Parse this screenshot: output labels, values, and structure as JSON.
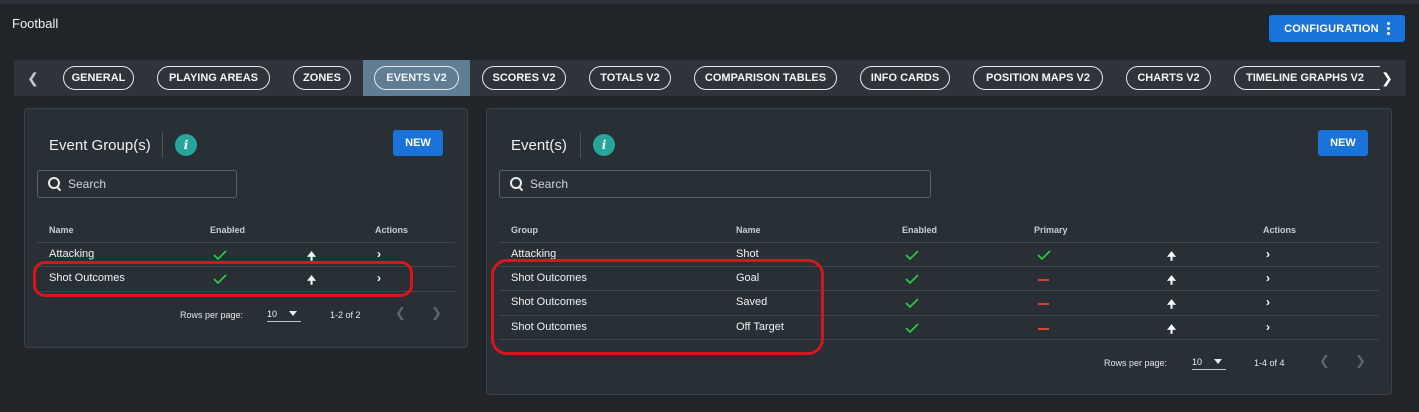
{
  "app": {
    "title": "Football",
    "configuration_label": "CONFIGURATION"
  },
  "tabs": [
    "GENERAL",
    "PLAYING AREAS",
    "ZONES",
    "EVENTS V2",
    "SCORES V2",
    "TOTALS V2",
    "COMPARISON TABLES",
    "INFO CARDS",
    "POSITION MAPS V2",
    "CHARTS V2",
    "TIMELINE GRAPHS V2"
  ],
  "active_tab": "EVENTS V2",
  "icons": {
    "prev": "chevron-left-icon",
    "next": "chevron-right-icon",
    "info": "info-icon",
    "search": "search-icon",
    "check": "check-icon",
    "dash": "dash-icon",
    "up": "arrow-up-icon",
    "row_action": "chevron-right-icon",
    "kebab": "more-vert-icon"
  },
  "colors": {
    "accent": "#1a73d9",
    "info": "#26a69a",
    "check": "#2ecc40",
    "dash": "#d5462f",
    "highlight": "#d8141c",
    "active_tab": "#5f7d94"
  },
  "event_groups": {
    "title": "Event Group(s)",
    "new_label": "NEW",
    "search_placeholder": "Search",
    "columns": {
      "name": "Name",
      "enabled": "Enabled",
      "actions": "Actions"
    },
    "rows": [
      {
        "name": "Attacking",
        "enabled": true
      },
      {
        "name": "Shot Outcomes",
        "enabled": true
      }
    ],
    "pagination": {
      "rows_label": "Rows per page:",
      "rows_value": "10",
      "range": "1-2 of 2"
    }
  },
  "events": {
    "title": "Event(s)",
    "new_label": "NEW",
    "search_placeholder": "Search",
    "columns": {
      "group": "Group",
      "name": "Name",
      "enabled": "Enabled",
      "primary": "Primary",
      "actions": "Actions"
    },
    "rows": [
      {
        "group": "Attacking",
        "name": "Shot",
        "enabled": true,
        "primary": true
      },
      {
        "group": "Shot Outcomes",
        "name": "Goal",
        "enabled": true,
        "primary": false
      },
      {
        "group": "Shot Outcomes",
        "name": "Saved",
        "enabled": true,
        "primary": false
      },
      {
        "group": "Shot Outcomes",
        "name": "Off Target",
        "enabled": true,
        "primary": false
      }
    ],
    "pagination": {
      "rows_label": "Rows per page:",
      "rows_value": "10",
      "range": "1-4 of 4"
    }
  }
}
